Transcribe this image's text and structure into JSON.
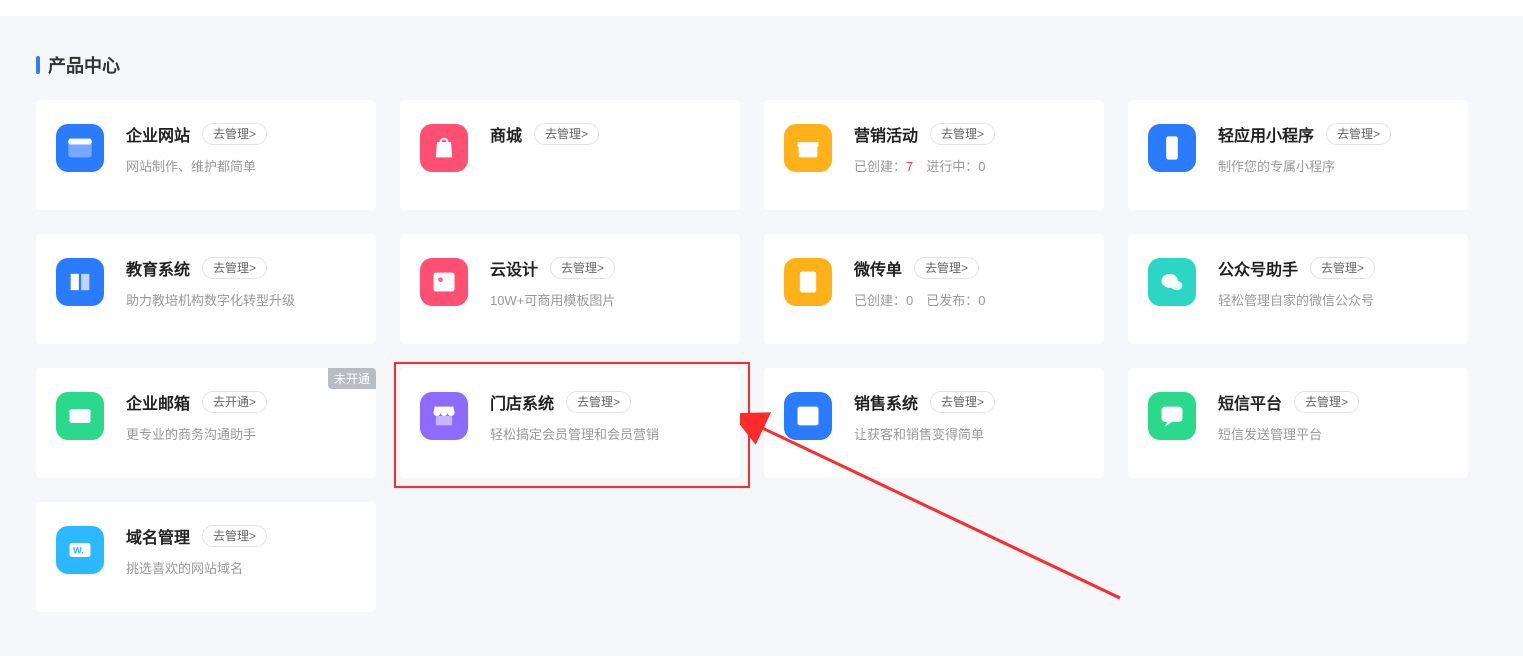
{
  "section_title": "产品中心",
  "cards": [
    {
      "id": "website",
      "title": "企业网站",
      "button": "去管理>",
      "desc": "网站制作、维护都简单",
      "icon_bg": "#2b7bff",
      "icon": "browser"
    },
    {
      "id": "mall",
      "title": "商城",
      "button": "去管理>",
      "desc": "",
      "icon_bg": "#ff5074",
      "icon": "bag"
    },
    {
      "id": "marketing",
      "title": "营销活动",
      "button": "去管理>",
      "desc_parts": [
        {
          "label": "已创建：",
          "value": "7",
          "red": true
        },
        {
          "label": "进行中：",
          "value": "0"
        }
      ],
      "icon_bg": "#ffb11a",
      "icon": "gift"
    },
    {
      "id": "miniapp",
      "title": "轻应用小程序",
      "button": "去管理>",
      "desc": "制作您的专属小程序",
      "icon_bg": "#2b7bff",
      "icon": "phone"
    },
    {
      "id": "edu",
      "title": "教育系统",
      "button": "去管理>",
      "desc": "助力教培机构数字化转型升级",
      "icon_bg": "#2b7bff",
      "icon": "book"
    },
    {
      "id": "design",
      "title": "云设计",
      "button": "去管理>",
      "desc": "10W+可商用模板图片",
      "icon_bg": "#ff5074",
      "icon": "image"
    },
    {
      "id": "flyer",
      "title": "微传单",
      "button": "去管理>",
      "desc_parts": [
        {
          "label": "已创建：",
          "value": "0"
        },
        {
          "label": "已发布：",
          "value": "0"
        }
      ],
      "icon_bg": "#ffb11a",
      "icon": "file"
    },
    {
      "id": "wx",
      "title": "公众号助手",
      "button": "去管理>",
      "desc": "轻松管理自家的微信公众号",
      "icon_bg": "#2bd6c4",
      "icon": "wechat"
    },
    {
      "id": "mail",
      "title": "企业邮箱",
      "button": "去开通>",
      "desc": "更专业的商务沟通助手",
      "badge": "未开通",
      "icon_bg": "#2bd98c",
      "icon": "mail"
    },
    {
      "id": "store",
      "title": "门店系统",
      "button": "去管理>",
      "desc": "轻松搞定会员管理和会员营销",
      "icon_bg": "#8e6bff",
      "icon": "shop"
    },
    {
      "id": "sales",
      "title": "销售系统",
      "button": "去管理>",
      "desc": "让获客和销售变得简单",
      "icon_bg": "#2b7bff",
      "icon": "list"
    },
    {
      "id": "sms",
      "title": "短信平台",
      "button": "去管理>",
      "desc": "短信发送管理平台",
      "icon_bg": "#2bd98c",
      "icon": "chat"
    },
    {
      "id": "domain",
      "title": "域名管理",
      "button": "去管理>",
      "desc": "挑选喜欢的网站域名",
      "icon_bg": "#2bb8ff",
      "icon": "domain"
    }
  ],
  "highlight_card": "store"
}
